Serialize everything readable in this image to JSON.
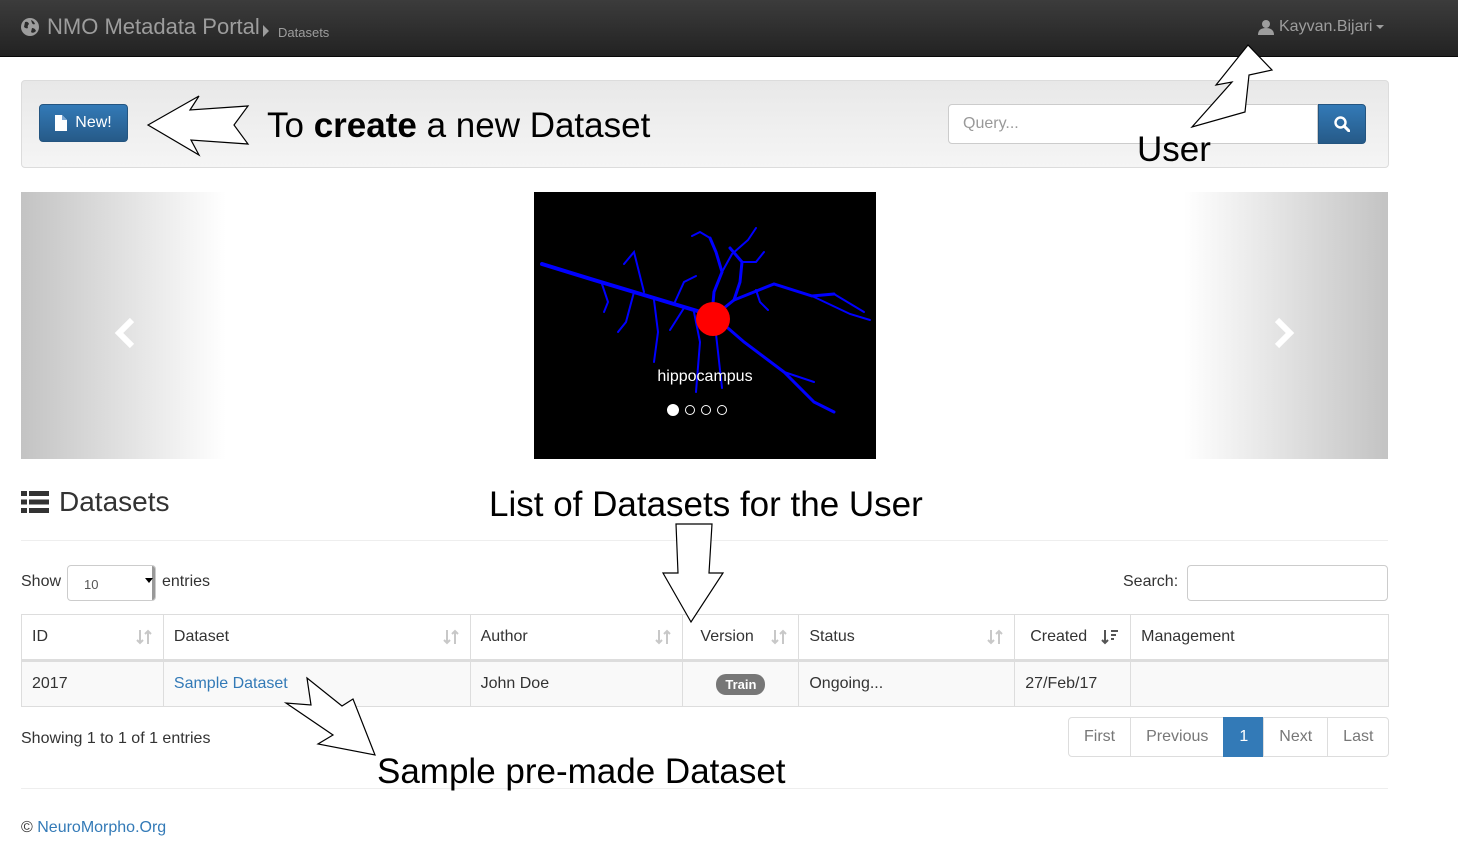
{
  "navbar": {
    "brand": "NMO Metadata Portal",
    "breadcrumb": "Datasets",
    "user": "Kayvan.Bijari"
  },
  "toolbar": {
    "new_label": "New!",
    "query_placeholder": "Query..."
  },
  "carousel": {
    "caption": "hippocampus",
    "slide_count": 4,
    "active_slide": 1
  },
  "datasets": {
    "title": "Datasets",
    "show_label": "Show",
    "page_length": "10",
    "entries_label": "entries",
    "search_label": "Search:",
    "columns": [
      "ID",
      "Dataset",
      "Author",
      "Version",
      "Status",
      "Created",
      "Management"
    ],
    "rows": [
      {
        "id": "2017",
        "dataset": "Sample Dataset",
        "author": "John Doe",
        "version": "Train",
        "status": "Ongoing...",
        "created": "27/Feb/17",
        "management": ""
      }
    ],
    "info": "Showing 1 to 1 of 1 entries",
    "pagination": {
      "first": "First",
      "previous": "Previous",
      "current": "1",
      "next": "Next",
      "last": "Last"
    }
  },
  "footer": {
    "copyright": "©",
    "link": "NeuroMorpho.Org"
  },
  "annotations": {
    "create_prefix": "To ",
    "create_bold": "create",
    "create_suffix": " a new Dataset",
    "user": "User",
    "list": "List of Datasets for the User",
    "sample": "Sample pre-made Dataset"
  },
  "colors": {
    "navbar": "#222222",
    "primary": "#337ab7",
    "badge": "#777777",
    "neuron": "#0000ff",
    "soma": "#ff0000"
  }
}
